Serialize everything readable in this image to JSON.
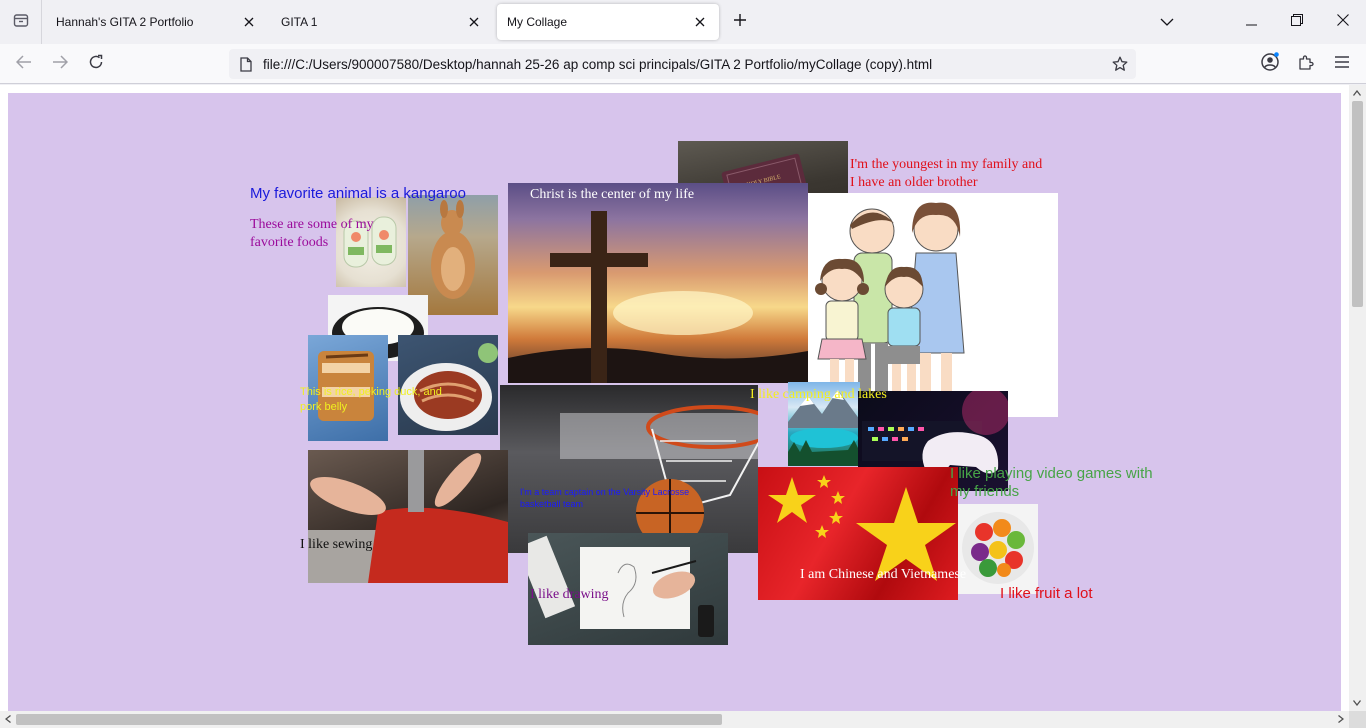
{
  "browser": {
    "tabs": [
      {
        "title": "Hannah's GITA 2 Portfolio",
        "active": false
      },
      {
        "title": "GITA 1",
        "active": false
      },
      {
        "title": "My Collage",
        "active": true
      }
    ],
    "url": "file:///C:/Users/900007580/Desktop/hannah 25-26 ap comp sci principals/GITA 2 Portfolio/myCollage (copy).html",
    "icons": {
      "tab_list": "tab-list-icon",
      "new_tab": "plus-icon",
      "back": "back-arrow-icon",
      "forward": "forward-arrow-icon",
      "reload": "reload-icon",
      "page": "page-icon",
      "bookmark": "star-icon",
      "account": "account-icon",
      "extensions": "puzzle-icon",
      "menu": "hamburger-menu-icon"
    }
  },
  "collage": {
    "background": "#d7c4ec",
    "captions": {
      "kangaroo": "My favorite animal is a kangaroo",
      "foods": "These are some of my favorite foods",
      "rice": "This is rice, peking duck, and pork belly",
      "christ": "Christ is the center of my life",
      "family": "I'm the youngest in my family and I have an older brother",
      "camping": "I like camping and lakes",
      "games": "I like playing video games with my friends",
      "basketball": "I'm a team captain on the Varsity Lacrosse basketball team",
      "sewing": "I like sewing",
      "drawing": "I like drawing",
      "heritage": "I am Chinese and Vietnamese",
      "fruit": "I like fruit a lot"
    },
    "image_labels": {
      "bible": "HOLY BIBLE"
    },
    "colors": {
      "kangaroo_text": "#1a1adb",
      "foods_text": "#9b0a9b",
      "rice_text": "#f0f020",
      "christ_text": "#ffffff",
      "family_text": "#e0101a",
      "camping_text": "#f3ee1e",
      "games_text": "#47a447",
      "basketball_text": "#1a1aff",
      "sewing_text": "#111111",
      "drawing_text": "#7a0f8a",
      "heritage_text": "#ffffff",
      "fruit_text": "#e0101a"
    }
  }
}
